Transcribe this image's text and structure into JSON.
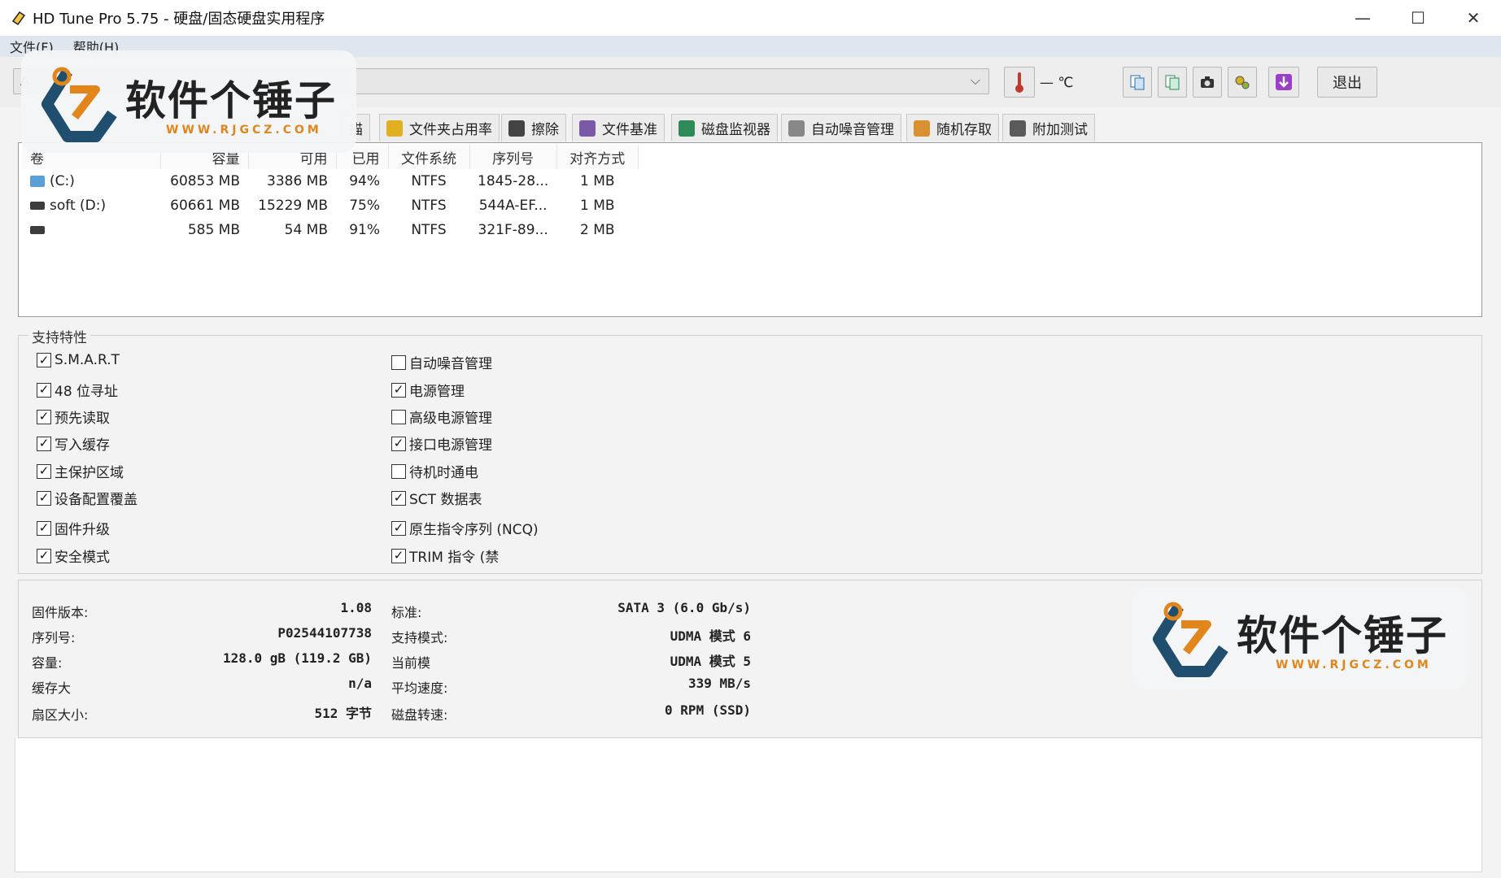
{
  "window": {
    "title": "HD Tune Pro 5.75 - 硬盘/固态硬盘实用程序",
    "minimize": "—",
    "maximize": "☐",
    "close": "✕"
  },
  "menu": [
    {
      "label": "文件(F)"
    },
    {
      "label": "帮助(H)"
    }
  ],
  "toolbar": {
    "drive_value": "A",
    "temperature": "— ℃",
    "exit_label": "退出"
  },
  "tabs": [
    {
      "label": "描",
      "color": "#3a8fd8"
    },
    {
      "label": "文件夹占用率",
      "color": "#e0b020"
    },
    {
      "label": "擦除",
      "color": "#444444"
    },
    {
      "label": "文件基准",
      "color": "#7a5aa8"
    },
    {
      "label": "磁盘监视器",
      "color": "#2e8b57"
    },
    {
      "label": "自动噪音管理",
      "color": "#888888"
    },
    {
      "label": "随机存取",
      "color": "#d89030"
    },
    {
      "label": "附加测试",
      "color": "#5a5a5a"
    }
  ],
  "volumes": {
    "headers": [
      "卷",
      "容量",
      "可用",
      "已用",
      "文件系统",
      "序列号",
      "对齐方式"
    ],
    "rows": [
      {
        "name": "(C:)",
        "capacity": "60853 MB",
        "free": "3386 MB",
        "used": "94%",
        "fs": "NTFS",
        "serial": "1845-28...",
        "align": "1 MB"
      },
      {
        "name": "soft (D:)",
        "capacity": "60661 MB",
        "free": "15229 MB",
        "used": "75%",
        "fs": "NTFS",
        "serial": "544A-EF...",
        "align": "1 MB"
      },
      {
        "name": "",
        "capacity": "585 MB",
        "free": "54 MB",
        "used": "91%",
        "fs": "NTFS",
        "serial": "321F-89...",
        "align": "2 MB"
      }
    ]
  },
  "features": {
    "title": "支持特性",
    "left": [
      {
        "label": "S.M.A.R.T",
        "checked": true
      },
      {
        "label": "48 位寻址",
        "checked": true
      },
      {
        "label": "预先读取",
        "checked": true
      },
      {
        "label": "写入缓存",
        "checked": true
      },
      {
        "label": "主保护区域",
        "checked": true
      },
      {
        "label": "设备配置覆盖",
        "checked": true
      },
      {
        "label": "固件升级",
        "checked": true
      },
      {
        "label": "安全模式",
        "checked": true
      }
    ],
    "right": [
      {
        "label": "自动噪音管理",
        "checked": false
      },
      {
        "label": "电源管理",
        "checked": true
      },
      {
        "label": "高级电源管理",
        "checked": false
      },
      {
        "label": "接口电源管理",
        "checked": true
      },
      {
        "label": "待机时通电",
        "checked": false
      },
      {
        "label": "SCT 数据表",
        "checked": true
      },
      {
        "label": "原生指令序列 (NCQ)",
        "checked": true
      },
      {
        "label": "TRIM 指令 (禁",
        "checked": true
      }
    ]
  },
  "info": {
    "left": [
      {
        "label": "固件版本:",
        "value": "1.08"
      },
      {
        "label": "序列号:",
        "value": "P02544107738"
      },
      {
        "label": "容量:",
        "value": "128.0 gB (119.2 GB)"
      },
      {
        "label": "缓存大",
        "value": "n/a"
      },
      {
        "label": "扇区大小:",
        "value": "512 字节"
      }
    ],
    "right": [
      {
        "label": "标准:",
        "value": "SATA 3 (6.0 Gb/s)"
      },
      {
        "label": "支持模式:",
        "value": "UDMA 模式 6"
      },
      {
        "label": "当前模",
        "value": "UDMA 模式 5"
      },
      {
        "label": "平均速度:",
        "value": "339 MB/s"
      },
      {
        "label": "磁盘转速:",
        "value": "0 RPM (SSD)"
      }
    ]
  },
  "watermark": {
    "text": "软件个锤子",
    "sub": "WWW.RJGCZ.COM",
    "accent": "#e2861c",
    "brand": "#1f4e6e"
  }
}
